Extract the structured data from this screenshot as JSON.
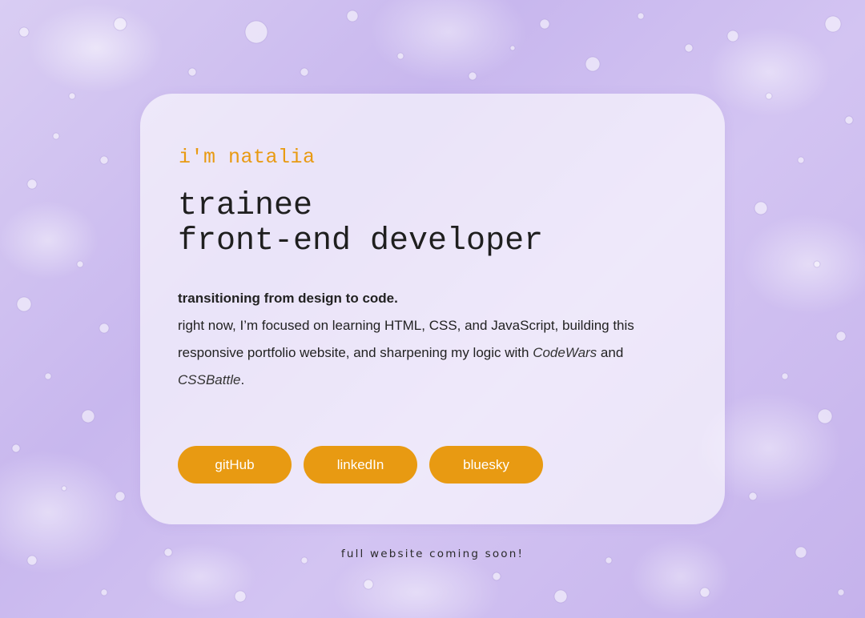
{
  "hero": {
    "greeting": "i'm natalia",
    "headline_line1": "trainee",
    "headline_line2": "front-end developer",
    "lead": "transitioning from design to code.",
    "body_part1": "right now, I’m focused on learning HTML, CSS, and JavaScript, building this responsive portfolio website, and sharpening my logic with ",
    "link1": "CodeWars",
    "body_and": " and ",
    "link2": "CSSBattle",
    "body_end": "."
  },
  "buttons": {
    "github": "gitHub",
    "linkedin": "linkedIn",
    "bluesky": "bluesky"
  },
  "footer": {
    "note": "full website coming soon!"
  },
  "colors": {
    "accent": "#e89a12",
    "background": "#cdbdf0",
    "text": "#1f1f1f"
  }
}
